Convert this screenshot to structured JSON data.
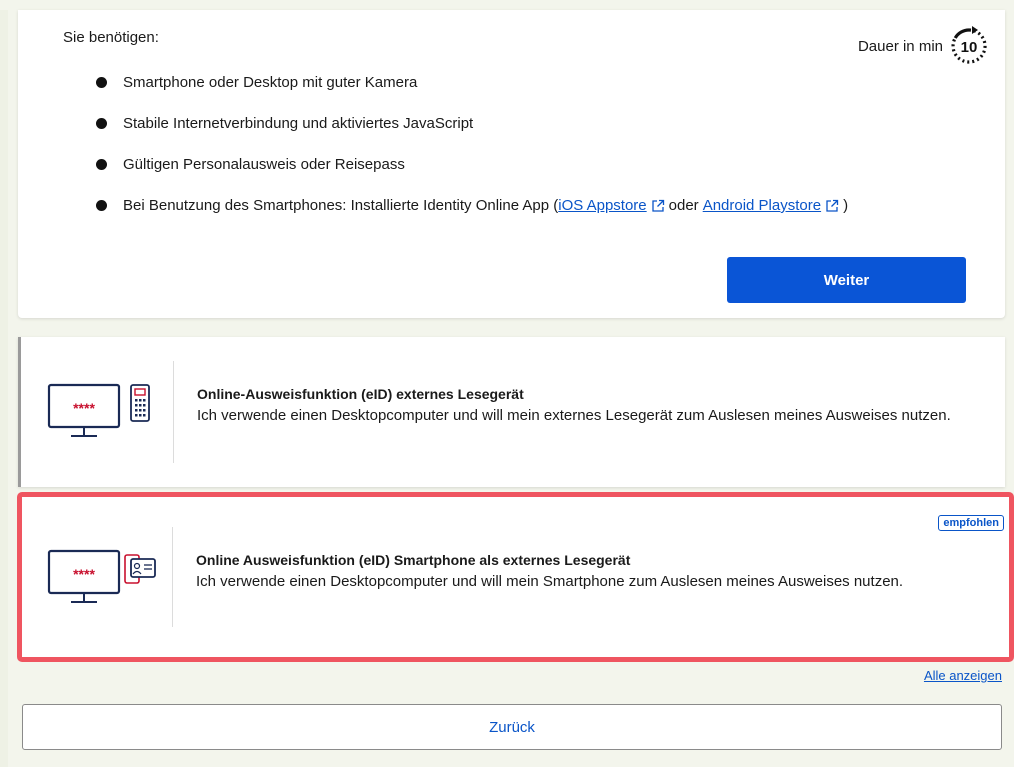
{
  "requirements": {
    "title": "Sie benötigen:",
    "duration_label": "Dauer in min",
    "duration_value": "10",
    "items": [
      "Smartphone oder Desktop mit guter Kamera",
      "Stabile Internetverbindung und aktiviertes JavaScript",
      "Gültigen Personalausweis oder Reisepass"
    ],
    "smartphone_item": {
      "prefix": "Bei Benutzung des Smartphones: Installierte Identity Online App (",
      "link_ios": "iOS Appstore",
      "middle": "oder",
      "link_android": "Android Playstore",
      "suffix": ")"
    },
    "next_label": "Weiter"
  },
  "options": [
    {
      "title": "Online-Ausweisfunktion (eID) externes Lesegerät",
      "description": "Ich verwende einen Desktopcomputer und will mein externes Lesegerät zum Auslesen meines Ausweises nutzen.",
      "icon": "desktop-card-reader-icon",
      "screen_text": "****"
    },
    {
      "title": "Online Ausweisfunktion (eID) Smartphone als externes Lesegerät",
      "description": "Ich verwende einen Desktopcomputer und will mein Smartphone zum Auslesen meines Ausweises nutzen.",
      "icon": "desktop-smartphone-icon",
      "badge": "empfohlen",
      "screen_text": "****"
    }
  ],
  "show_all_label": "Alle anzeigen",
  "back_label": "Zurück",
  "colors": {
    "primary": "#0a55d6",
    "link": "#0a55c8",
    "highlight_border": "#ef5560",
    "accent_red": "#c8102e"
  }
}
